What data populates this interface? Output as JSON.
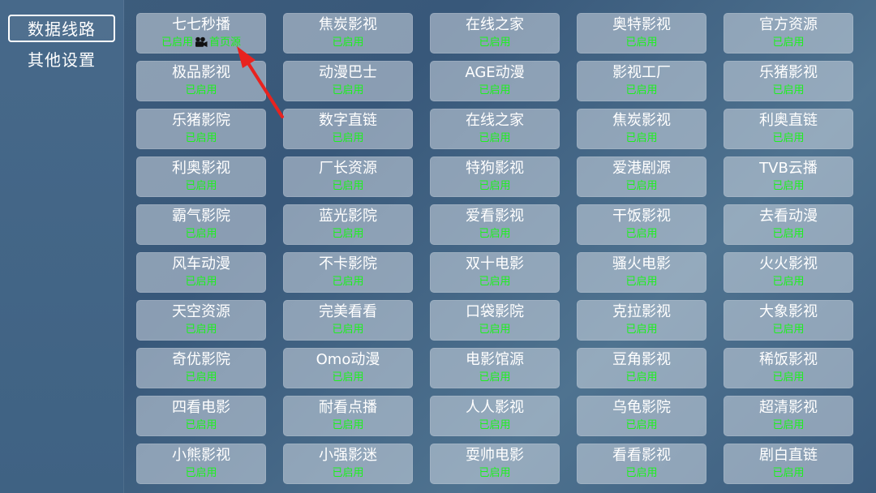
{
  "sidebar": {
    "items": [
      {
        "label": "数据线路",
        "active": true
      },
      {
        "label": "其他设置",
        "active": false
      }
    ]
  },
  "sources": [
    {
      "name": "七七秒播",
      "status": "已启用",
      "home_tag": "首页源",
      "icon": "film-camera-icon"
    },
    {
      "name": "焦炭影视",
      "status": "已启用"
    },
    {
      "name": "在线之家",
      "status": "已启用"
    },
    {
      "name": "奥特影视",
      "status": "已启用"
    },
    {
      "name": "官方资源",
      "status": "已启用"
    },
    {
      "name": "极品影视",
      "status": "已启用"
    },
    {
      "name": "动漫巴士",
      "status": "已启用"
    },
    {
      "name": "AGE动漫",
      "status": "已启用"
    },
    {
      "name": "影视工厂",
      "status": "已启用"
    },
    {
      "name": "乐猪影视",
      "status": "已启用"
    },
    {
      "name": "乐猪影院",
      "status": "已启用"
    },
    {
      "name": "数字直链",
      "status": "已启用"
    },
    {
      "name": "在线之家",
      "status": "已启用"
    },
    {
      "name": "焦炭影视",
      "status": "已启用"
    },
    {
      "name": "利奥直链",
      "status": "已启用"
    },
    {
      "name": "利奥影视",
      "status": "已启用"
    },
    {
      "name": "厂长资源",
      "status": "已启用"
    },
    {
      "name": "特狗影视",
      "status": "已启用"
    },
    {
      "name": "爱港剧源",
      "status": "已启用"
    },
    {
      "name": "TVB云播",
      "status": "已启用"
    },
    {
      "name": "霸气影院",
      "status": "已启用"
    },
    {
      "name": "蓝光影院",
      "status": "已启用"
    },
    {
      "name": "爱看影视",
      "status": "已启用"
    },
    {
      "name": "干饭影视",
      "status": "已启用"
    },
    {
      "name": "去看动漫",
      "status": "已启用"
    },
    {
      "name": "风车动漫",
      "status": "已启用"
    },
    {
      "name": "不卡影院",
      "status": "已启用"
    },
    {
      "name": "双十电影",
      "status": "已启用"
    },
    {
      "name": "骚火电影",
      "status": "已启用"
    },
    {
      "name": "火火影视",
      "status": "已启用"
    },
    {
      "name": "天空资源",
      "status": "已启用"
    },
    {
      "name": "完美看看",
      "status": "已启用"
    },
    {
      "name": "口袋影院",
      "status": "已启用"
    },
    {
      "name": "克拉影视",
      "status": "已启用"
    },
    {
      "name": "大象影视",
      "status": "已启用"
    },
    {
      "name": "奇优影院",
      "status": "已启用"
    },
    {
      "name": "Omo动漫",
      "status": "已启用"
    },
    {
      "name": "电影馆源",
      "status": "已启用"
    },
    {
      "name": "豆角影视",
      "status": "已启用"
    },
    {
      "name": "稀饭影视",
      "status": "已启用"
    },
    {
      "name": "四看电影",
      "status": "已启用"
    },
    {
      "name": "耐看点播",
      "status": "已启用"
    },
    {
      "name": "人人影视",
      "status": "已启用"
    },
    {
      "name": "乌龟影院",
      "status": "已启用"
    },
    {
      "name": "超清影视",
      "status": "已启用"
    },
    {
      "name": "小熊影视",
      "status": "已启用"
    },
    {
      "name": "小强影迷",
      "status": "已启用"
    },
    {
      "name": "耍帅电影",
      "status": "已启用"
    },
    {
      "name": "看看影视",
      "status": "已启用"
    },
    {
      "name": "剧白直链",
      "status": "已启用"
    }
  ],
  "colors": {
    "status_green": "#1cf21c",
    "annotation_arrow": "#e8231f"
  }
}
